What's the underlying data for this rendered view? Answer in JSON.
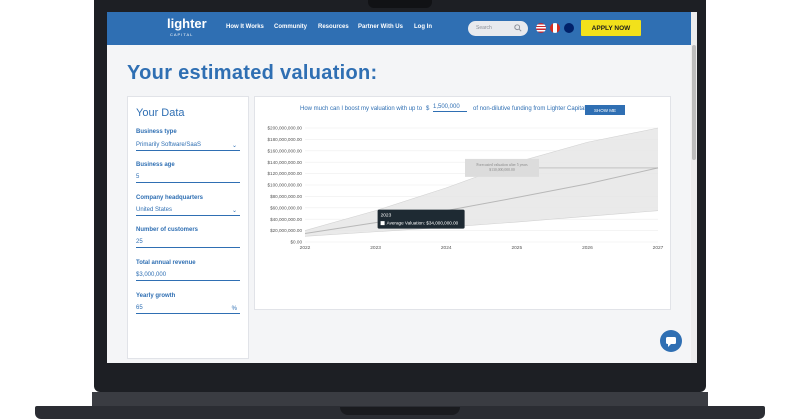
{
  "nav": {
    "logo": "lighter",
    "logo_sub": "CAPITAL",
    "links": [
      "How It Works",
      "Community",
      "Resources",
      "Partner With Us",
      "Log In"
    ],
    "search_placeholder": "Search",
    "apply_label": "APPLY NOW",
    "flags": [
      "us-flag",
      "canada-flag",
      "australia-flag"
    ]
  },
  "page": {
    "title": "Your estimated valuation:"
  },
  "your_data": {
    "title": "Your Data",
    "fields": [
      {
        "label": "Business type",
        "value": "Primarily Software/SaaS",
        "type": "select"
      },
      {
        "label": "Business age",
        "value": "5",
        "type": "input"
      },
      {
        "label": "Company headquarters",
        "value": "United States",
        "type": "select"
      },
      {
        "label": "Number of customers",
        "value": "25",
        "type": "input"
      },
      {
        "label": "Total annual revenue",
        "value": "$3,000,000",
        "type": "input"
      },
      {
        "label": "Yearly growth",
        "value": "65",
        "type": "input",
        "suffix": "%"
      }
    ]
  },
  "funding": {
    "question_prefix": "How much can I boost my valuation with up to",
    "currency": "$",
    "amount": "1,500,000",
    "question_suffix": "of non-dilutive funding from Lighter Capital?",
    "show_me_label": "SHOW ME"
  },
  "chart_data": {
    "type": "area",
    "x": [
      2022,
      2023,
      2024,
      2025,
      2026,
      2027
    ],
    "y_ticks": [
      "$200,000,000.00",
      "$180,000,000.00",
      "$160,000,000.00",
      "$140,000,000.00",
      "$120,000,000.00",
      "$100,000,000.00",
      "$80,000,000.00",
      "$60,000,000.00",
      "$40,000,000.00",
      "$20,000,000.00",
      "$0.00"
    ],
    "ylim": [
      0,
      200000000
    ],
    "series": [
      {
        "values": [
          15000000,
          34000000,
          55000000,
          78000000,
          102000000,
          130000000
        ]
      },
      {
        "values": [
          20000000,
          55000000,
          95000000,
          140000000,
          175000000,
          200000000
        ]
      },
      {
        "values": [
          10000000,
          18000000,
          26000000,
          35000000,
          45000000,
          55000000
        ]
      }
    ],
    "tooltip": {
      "year": "2023",
      "label": "Average Valuation: $34,000,000.00"
    },
    "annotation": {
      "line1": "Forecasted valuation after 5 years",
      "line2": "$130,000,000.00"
    },
    "colors": {
      "line": "#bfbfbf",
      "band": "#e6e6e6",
      "tooltip_bg": "#1e2a33"
    }
  }
}
